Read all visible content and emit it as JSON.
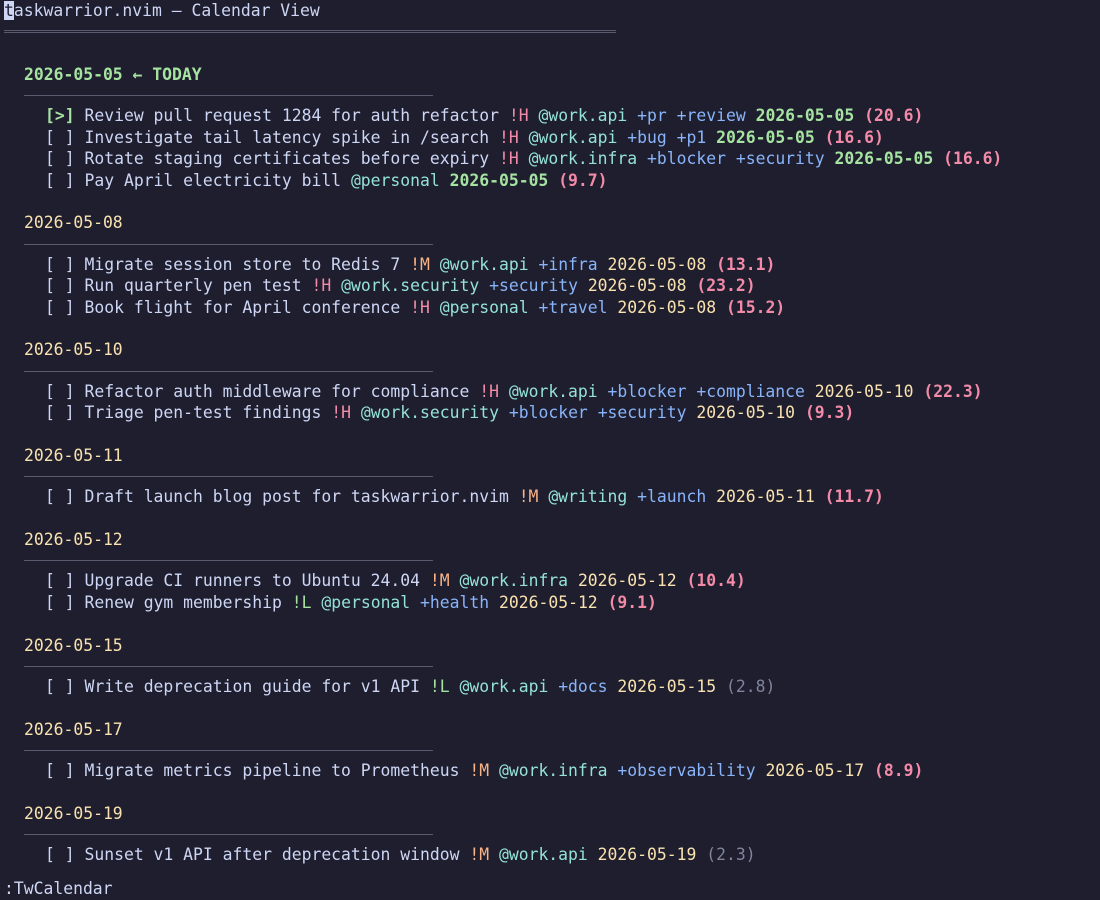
{
  "window": {
    "title_first_char": "t",
    "title_rest": "askwarrior.nvim — Calendar View"
  },
  "colors": {
    "background": "#1e1e2e",
    "text": "#cdd6f4",
    "today": "#a6e3a1",
    "date": "#f9e2af",
    "priority_high": "#f38ba8",
    "priority_medium": "#fab387",
    "priority_low": "#a6e3a1",
    "project": "#94e2d5",
    "tag": "#89b4fa",
    "urgency": "#f38ba8",
    "urgency_low": "#7f849c"
  },
  "groups": [
    {
      "header": "2026-05-05 ← TODAY",
      "is_today": true,
      "tasks": [
        {
          "checkbox": "[>]",
          "active": true,
          "description": "Review pull request 1284 for auth refactor",
          "priority": "!H",
          "priority_level": "H",
          "project": "@work.api",
          "tags": [
            "+pr",
            "+review"
          ],
          "due": "2026-05-05",
          "urgency": "(20.6)",
          "urgency_low": false
        },
        {
          "checkbox": "[ ]",
          "active": false,
          "description": "Investigate tail latency spike in /search",
          "priority": "!H",
          "priority_level": "H",
          "project": "@work.api",
          "tags": [
            "+bug",
            "+p1"
          ],
          "due": "2026-05-05",
          "urgency": "(16.6)",
          "urgency_low": false
        },
        {
          "checkbox": "[ ]",
          "active": false,
          "description": "Rotate staging certificates before expiry",
          "priority": "!H",
          "priority_level": "H",
          "project": "@work.infra",
          "tags": [
            "+blocker",
            "+security"
          ],
          "due": "2026-05-05",
          "urgency": "(16.6)",
          "urgency_low": false
        },
        {
          "checkbox": "[ ]",
          "active": false,
          "description": "Pay April electricity bill",
          "priority": "",
          "priority_level": "",
          "project": "@personal",
          "tags": [],
          "due": "2026-05-05",
          "urgency": "(9.7)",
          "urgency_low": false
        }
      ]
    },
    {
      "header": "2026-05-08",
      "is_today": false,
      "tasks": [
        {
          "checkbox": "[ ]",
          "active": false,
          "description": "Migrate session store to Redis 7",
          "priority": "!M",
          "priority_level": "M",
          "project": "@work.api",
          "tags": [
            "+infra"
          ],
          "due": "2026-05-08",
          "urgency": "(13.1)",
          "urgency_low": false
        },
        {
          "checkbox": "[ ]",
          "active": false,
          "description": "Run quarterly pen test",
          "priority": "!H",
          "priority_level": "H",
          "project": "@work.security",
          "tags": [
            "+security"
          ],
          "due": "2026-05-08",
          "urgency": "(23.2)",
          "urgency_low": false
        },
        {
          "checkbox": "[ ]",
          "active": false,
          "description": "Book flight for April conference",
          "priority": "!H",
          "priority_level": "H",
          "project": "@personal",
          "tags": [
            "+travel"
          ],
          "due": "2026-05-08",
          "urgency": "(15.2)",
          "urgency_low": false
        }
      ]
    },
    {
      "header": "2026-05-10",
      "is_today": false,
      "tasks": [
        {
          "checkbox": "[ ]",
          "active": false,
          "description": "Refactor auth middleware for compliance",
          "priority": "!H",
          "priority_level": "H",
          "project": "@work.api",
          "tags": [
            "+blocker",
            "+compliance"
          ],
          "due": "2026-05-10",
          "urgency": "(22.3)",
          "urgency_low": false
        },
        {
          "checkbox": "[ ]",
          "active": false,
          "description": "Triage pen-test findings",
          "priority": "!H",
          "priority_level": "H",
          "project": "@work.security",
          "tags": [
            "+blocker",
            "+security"
          ],
          "due": "2026-05-10",
          "urgency": "(9.3)",
          "urgency_low": false
        }
      ]
    },
    {
      "header": "2026-05-11",
      "is_today": false,
      "tasks": [
        {
          "checkbox": "[ ]",
          "active": false,
          "description": "Draft launch blog post for taskwarrior.nvim",
          "priority": "!M",
          "priority_level": "M",
          "project": "@writing",
          "tags": [
            "+launch"
          ],
          "due": "2026-05-11",
          "urgency": "(11.7)",
          "urgency_low": false
        }
      ]
    },
    {
      "header": "2026-05-12",
      "is_today": false,
      "tasks": [
        {
          "checkbox": "[ ]",
          "active": false,
          "description": "Upgrade CI runners to Ubuntu 24.04",
          "priority": "!M",
          "priority_level": "M",
          "project": "@work.infra",
          "tags": [],
          "due": "2026-05-12",
          "urgency": "(10.4)",
          "urgency_low": false
        },
        {
          "checkbox": "[ ]",
          "active": false,
          "description": "Renew gym membership",
          "priority": "!L",
          "priority_level": "L",
          "project": "@personal",
          "tags": [
            "+health"
          ],
          "due": "2026-05-12",
          "urgency": "(9.1)",
          "urgency_low": false
        }
      ]
    },
    {
      "header": "2026-05-15",
      "is_today": false,
      "tasks": [
        {
          "checkbox": "[ ]",
          "active": false,
          "description": "Write deprecation guide for v1 API",
          "priority": "!L",
          "priority_level": "L",
          "project": "@work.api",
          "tags": [
            "+docs"
          ],
          "due": "2026-05-15",
          "urgency": "(2.8)",
          "urgency_low": true
        }
      ]
    },
    {
      "header": "2026-05-17",
      "is_today": false,
      "tasks": [
        {
          "checkbox": "[ ]",
          "active": false,
          "description": "Migrate metrics pipeline to Prometheus",
          "priority": "!M",
          "priority_level": "M",
          "project": "@work.infra",
          "tags": [
            "+observability"
          ],
          "due": "2026-05-17",
          "urgency": "(8.9)",
          "urgency_low": false
        }
      ]
    },
    {
      "header": "2026-05-19",
      "is_today": false,
      "tasks": [
        {
          "checkbox": "[ ]",
          "active": false,
          "description": "Sunset v1 API after deprecation window",
          "priority": "!M",
          "priority_level": "M",
          "project": "@work.api",
          "tags": [],
          "due": "2026-05-19",
          "urgency": "(2.3)",
          "urgency_low": true
        }
      ]
    }
  ],
  "cmdline": ":TwCalendar"
}
